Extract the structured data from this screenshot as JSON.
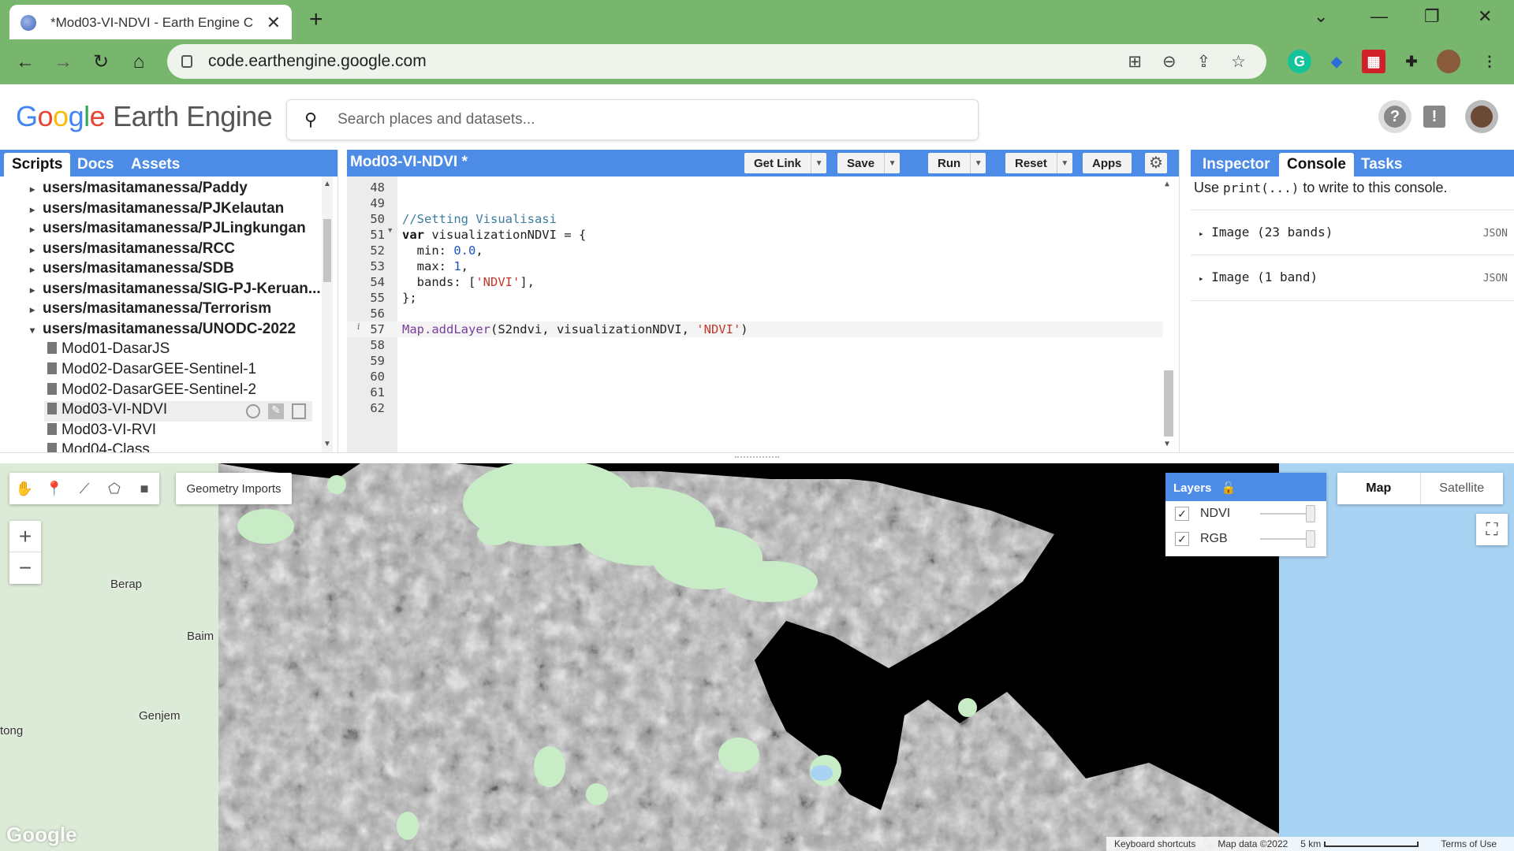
{
  "browser": {
    "tab_title": "*Mod03-VI-NDVI - Earth Engine C",
    "url": "code.earthengine.google.com"
  },
  "header": {
    "logo_google": [
      "G",
      "o",
      "o",
      "g",
      "l",
      "e"
    ],
    "logo_product": "Earth Engine",
    "search_placeholder": "Search places and datasets..."
  },
  "left_tabs": [
    "Scripts",
    "Docs",
    "Assets"
  ],
  "scripts": [
    {
      "label": "users/masitamanessa/Paddy",
      "type": "repo",
      "expanded": false
    },
    {
      "label": "users/masitamanessa/PJKelautan",
      "type": "repo",
      "expanded": false
    },
    {
      "label": "users/masitamanessa/PJLingkungan",
      "type": "repo",
      "expanded": false
    },
    {
      "label": "users/masitamanessa/RCC",
      "type": "repo",
      "expanded": false
    },
    {
      "label": "users/masitamanessa/SDB",
      "type": "repo",
      "expanded": false
    },
    {
      "label": "users/masitamanessa/SIG-PJ-Keruan...",
      "type": "repo",
      "expanded": false
    },
    {
      "label": "users/masitamanessa/Terrorism",
      "type": "repo",
      "expanded": false
    },
    {
      "label": "users/masitamanessa/UNODC-2022",
      "type": "repo",
      "expanded": true
    },
    {
      "label": "Mod01-DasarJS",
      "type": "file"
    },
    {
      "label": "Mod02-DasarGEE-Sentinel-1",
      "type": "file"
    },
    {
      "label": "Mod02-DasarGEE-Sentinel-2",
      "type": "file"
    },
    {
      "label": "Mod03-VI-NDVI",
      "type": "file",
      "selected": true
    },
    {
      "label": "Mod03-VI-RVI",
      "type": "file"
    },
    {
      "label": "Mod04-Class",
      "type": "file"
    }
  ],
  "editor": {
    "title": "Mod03-VI-NDVI *",
    "buttons": {
      "get_link": "Get Link",
      "save": "Save",
      "run": "Run",
      "reset": "Reset",
      "apps": "Apps"
    },
    "lines": [
      {
        "n": "48",
        "html": ""
      },
      {
        "n": "49",
        "html": ""
      },
      {
        "n": "50",
        "html": "<span class=\"cm\">//Setting Visualisasi</span>"
      },
      {
        "n": "51",
        "html": "<span class=\"kw\">var</span> visualizationNDVI = {"
      },
      {
        "n": "52",
        "html": "  min: <span class=\"num\">0.0</span>,"
      },
      {
        "n": "53",
        "html": "  max: <span class=\"num\">1</span>,"
      },
      {
        "n": "54",
        "html": "  bands: [<span class=\"str\">'NDVI'</span>],"
      },
      {
        "n": "55",
        "html": "};"
      },
      {
        "n": "56",
        "html": ""
      },
      {
        "n": "57",
        "html": "<span class=\"fn\">Map.addLayer</span>(S2ndvi, visualizationNDVI, <span class=\"str\">'NDVI'</span>)"
      },
      {
        "n": "58",
        "html": ""
      },
      {
        "n": "59",
        "html": ""
      },
      {
        "n": "60",
        "html": ""
      },
      {
        "n": "61",
        "html": ""
      },
      {
        "n": "62",
        "html": ""
      }
    ]
  },
  "right_tabs": [
    "Inspector",
    "Console",
    "Tasks"
  ],
  "console": {
    "help_prefix": "Use",
    "help_code": "print(...)",
    "help_suffix": "to write to this console.",
    "entries": [
      {
        "text": "Image (23 bands)",
        "tag": "JSON"
      },
      {
        "text": "Image (1 band)",
        "tag": "JSON"
      }
    ]
  },
  "map": {
    "geometry_imports": "Geometry Imports",
    "layers_title": "Layers",
    "layers": [
      {
        "name": "NDVI",
        "checked": true,
        "opacity": 1.0
      },
      {
        "name": "RGB",
        "checked": true,
        "opacity": 1.0
      }
    ],
    "map_types": [
      "Map",
      "Satellite"
    ],
    "places": [
      "Berap",
      "Baim",
      "Genjem",
      "tong"
    ],
    "footer": [
      "Keyboard shortcuts",
      "Map data ©2022",
      "5 km",
      "Terms of Use"
    ],
    "google_mark": "Google"
  },
  "colors": {
    "chrome_green": "#77b66c",
    "gee_blue": "#4c8be6",
    "ndvi_green": "#c7ecc6",
    "water_blue": "#a9d3f3"
  }
}
